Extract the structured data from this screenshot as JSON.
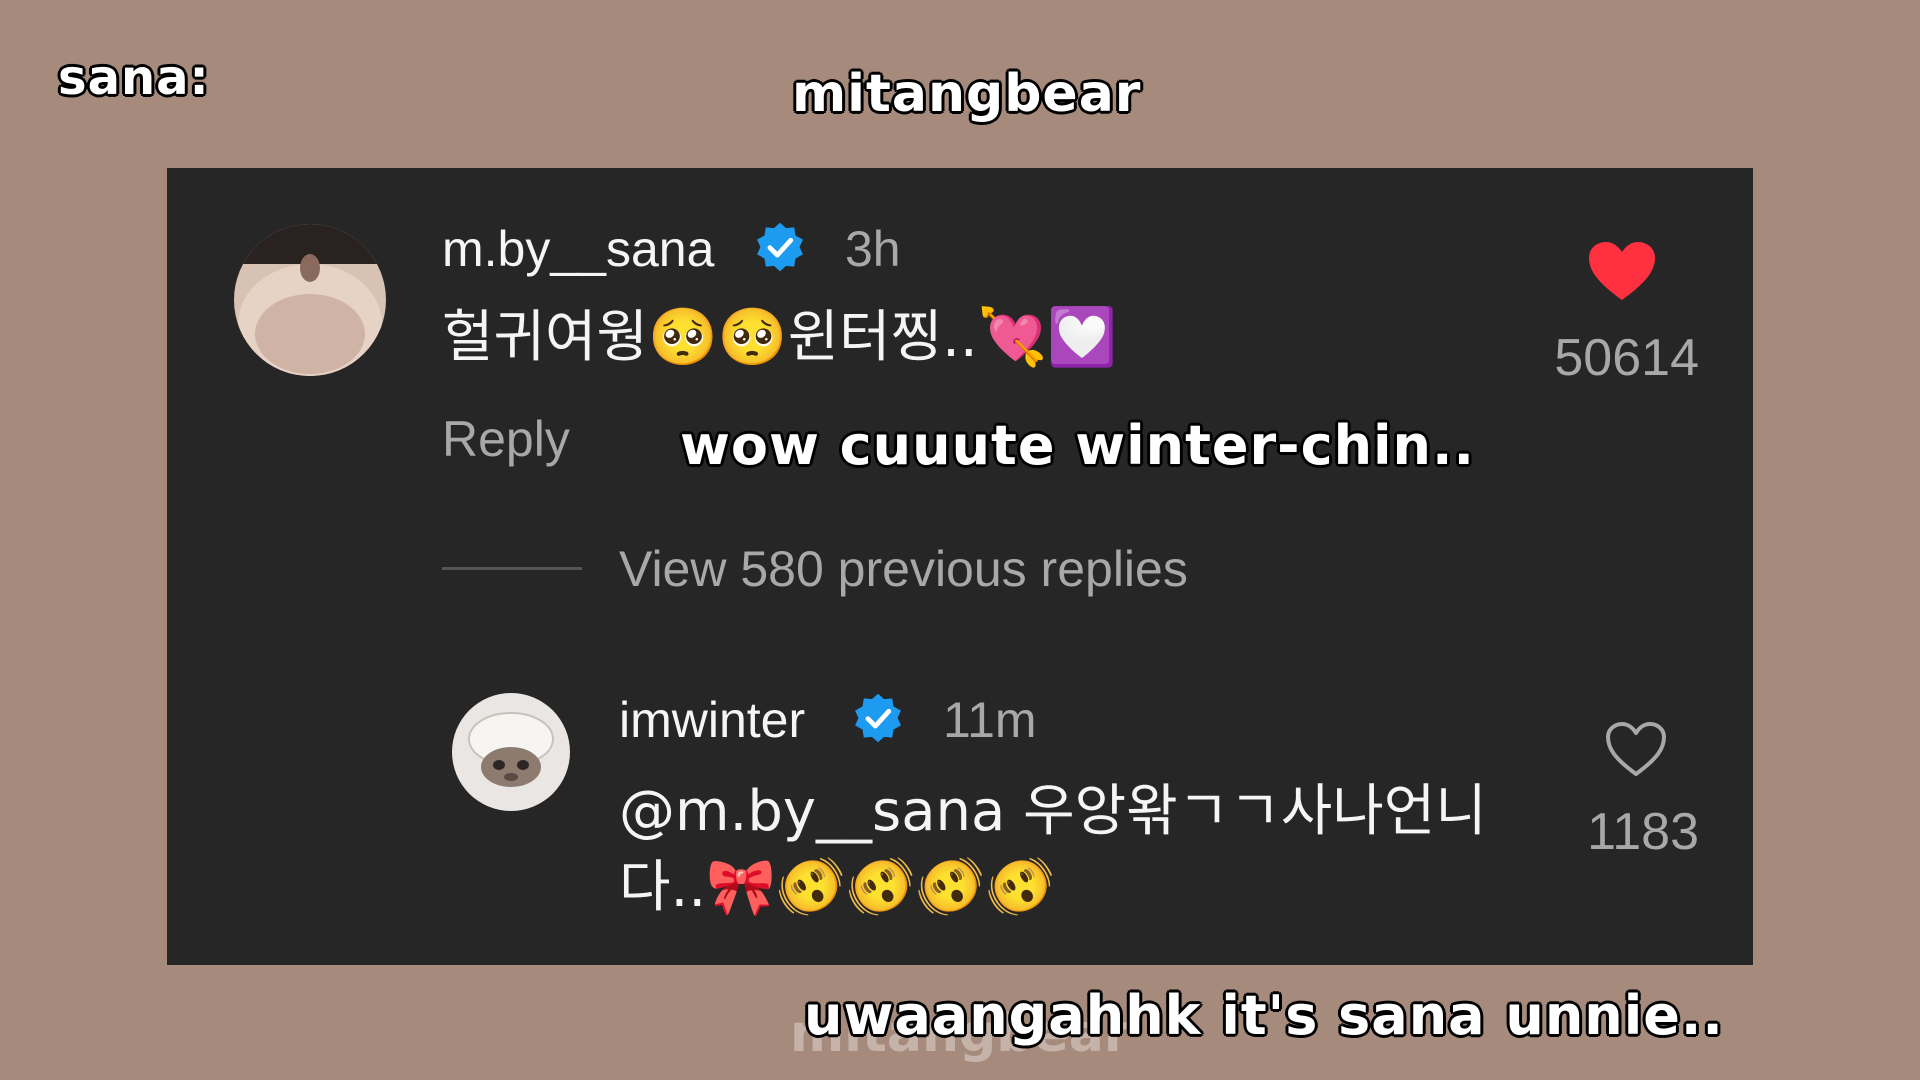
{
  "overlay": {
    "speaker_label": "sana:",
    "watermark": "mitangbear",
    "watermark_faded": "mitangbear",
    "subtitle_top": "wow cuuute winter-chin..",
    "subtitle_bottom": "uwaangahhk it's sana unnie.."
  },
  "comments": [
    {
      "username": "m.by__sana",
      "verified": true,
      "time": "3h",
      "text": "헐귀여웡🥺🥺윈터찡..💘💟",
      "reply_label": "Reply",
      "likes": "50614",
      "liked": true,
      "heart_icon": "heart-filled-icon"
    }
  ],
  "view_replies_label": "View 580 previous replies",
  "replies": [
    {
      "username": "imwinter",
      "verified": true,
      "time": "11m",
      "text": "@m.by__sana 우앙왂ㄱㄱ사나언니다..🎀🫨🫨🫨🫨",
      "likes": "1183",
      "liked": false,
      "heart_icon": "heart-outline-icon"
    }
  ],
  "colors": {
    "background": "#a68b7d",
    "panel": "#262626",
    "verified_badge": "#1d9bf0",
    "heart_liked": "#ff3040",
    "muted_text": "#a8a8a8"
  }
}
